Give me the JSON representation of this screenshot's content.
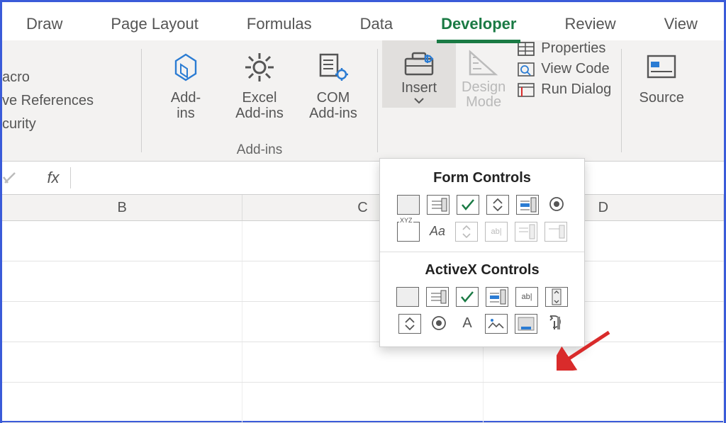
{
  "tabs": {
    "draw": "Draw",
    "layout": "Page Layout",
    "formulas": "Formulas",
    "data": "Data",
    "developer": "Developer",
    "review": "Review",
    "view": "View"
  },
  "leftcmds": {
    "macro": "acro",
    "relref": "ve References",
    "security": "curity"
  },
  "addins": {
    "group_label": "Add-ins",
    "addins": "Add-\nins",
    "excel": "Excel\nAdd-ins",
    "com": "COM\nAdd-ins"
  },
  "controls": {
    "insert": "Insert",
    "design": "Design\nMode",
    "properties": "Properties",
    "viewcode": "View Code",
    "rundialog": "Run Dialog"
  },
  "xml": {
    "source": "Source"
  },
  "formula_bar": {
    "fx": "fx",
    "value": ""
  },
  "columns": {
    "b": "B",
    "c": "C",
    "d": "D"
  },
  "dropdown": {
    "form_title": "Form Controls",
    "activex_title": "ActiveX Controls",
    "form_row1": [
      "button",
      "combo",
      "check",
      "spin",
      "list",
      "radio"
    ],
    "form_row2": [
      "group",
      "label",
      "scroll-disabled",
      "text-disabled",
      "combo-disabled",
      "image-disabled"
    ],
    "ax_row1": [
      "command",
      "combo",
      "check",
      "list",
      "text",
      "scroll"
    ],
    "ax_row2": [
      "spin",
      "radio",
      "label",
      "image",
      "frame",
      "more"
    ]
  }
}
